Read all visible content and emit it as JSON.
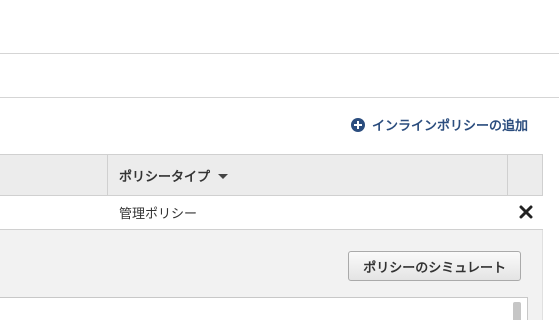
{
  "header": {
    "add_inline_policy_label": "インラインポリシーの追加"
  },
  "policy_table": {
    "columns": {
      "policy_type": "ポリシータイプ"
    },
    "rows": [
      {
        "policy_type": "管理ポリシー"
      }
    ]
  },
  "actions": {
    "simulate_policy_label": "ポリシーのシミュレート"
  },
  "colors": {
    "link": "#2b4d7e",
    "header_bg": "#ececec",
    "panel_bg": "#f2f2f2"
  },
  "icons": {
    "add": "plus-circle-icon",
    "sort": "caret-down-icon",
    "remove": "close-icon"
  }
}
